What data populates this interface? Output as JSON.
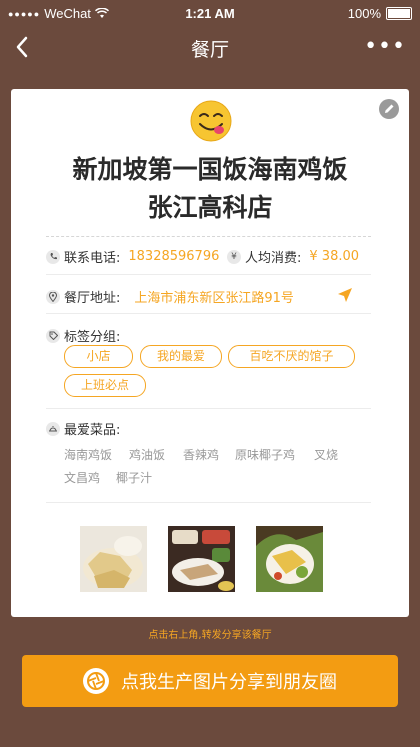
{
  "status_bar": {
    "carrier": "WeChat",
    "time": "1:21 AM",
    "battery": "100%"
  },
  "nav": {
    "title": "餐厅"
  },
  "restaurant": {
    "name_line1": "新加坡第一国饭海南鸡饭",
    "name_line2": "张江高科店",
    "phone_label": "联系电话:",
    "phone": "18328596796",
    "avg_label": "人均消费:",
    "avg_price": "¥ 38.00",
    "address_label": "餐厅地址:",
    "address": "上海市浦东新区张江路91号",
    "tags_label": "标签分组:",
    "tags": [
      "小店",
      "我的最爱",
      "百吃不厌的馆子",
      "上班必点"
    ],
    "dishes_label": "最爱菜品:",
    "dishes": [
      "海南鸡饭",
      "鸡油饭",
      "香辣鸡",
      "原味椰子鸡",
      "叉烧",
      "文昌鸡",
      "椰子汁"
    ]
  },
  "share": {
    "hint": "点击右上角,转发分享该餐厅",
    "button_label": "点我生产图片分享到朋友圈"
  },
  "colors": {
    "background": "#6b4a3d",
    "accent": "#f5a623",
    "button": "#f39c12"
  }
}
